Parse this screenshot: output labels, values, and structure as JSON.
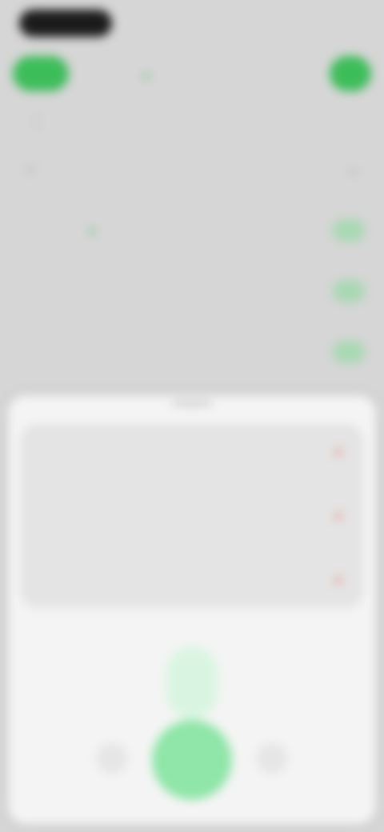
{
  "header": {
    "title": "",
    "left_button_label": "",
    "right_button_label": ""
  },
  "tabs": [
    {
      "label": ""
    },
    {
      "label": ""
    }
  ],
  "search": {
    "text": ""
  },
  "list": [
    {
      "left": "",
      "title": ""
    },
    {
      "left": "",
      "title": ""
    },
    {
      "left": "",
      "title": ""
    }
  ],
  "sheet": {
    "options": [
      {
        "text": ""
      },
      {
        "text": ""
      },
      {
        "text": ""
      }
    ]
  },
  "colors": {
    "accent_green": "#3dbd5a",
    "light_green": "#8fe6a8",
    "sheet_bg": "#f4f4f4",
    "option_bg": "#e4e4e4",
    "delete_orange": "#e07a5f"
  },
  "icons": {
    "search": "search-icon",
    "delete": "close-icon",
    "mic": "mic-icon"
  }
}
